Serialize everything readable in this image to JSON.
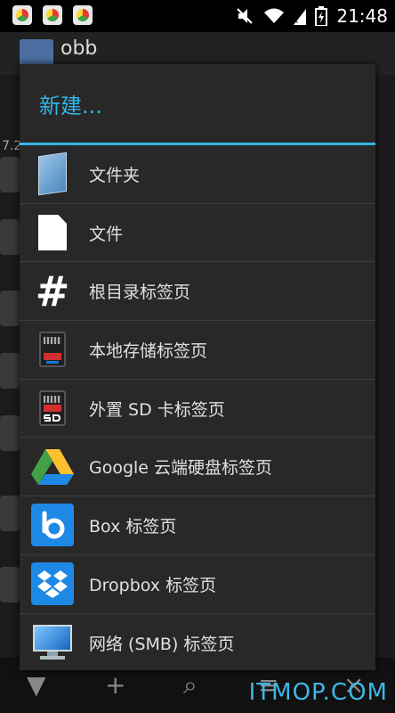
{
  "status_bar": {
    "time": "21:48",
    "icons": [
      "app-icon",
      "app-icon",
      "app-icon",
      "mute-icon",
      "wifi-icon",
      "signal-icon",
      "battery-icon"
    ]
  },
  "background": {
    "title": "obb",
    "side_text": "7.2",
    "watermark": "ITMOP.COM"
  },
  "dialog": {
    "title": "新建...",
    "accent_color": "#33b5e5",
    "items": [
      {
        "label": "文件夹",
        "icon": "folder-icon"
      },
      {
        "label": "文件",
        "icon": "file-icon"
      },
      {
        "label": "根目录标签页",
        "icon": "hash-icon"
      },
      {
        "label": "本地存储标签页",
        "icon": "sdcard-icon"
      },
      {
        "label": "外置 SD 卡标签页",
        "icon": "external-sdcard-icon"
      },
      {
        "label": "Google 云端硬盘标签页",
        "icon": "google-drive-icon"
      },
      {
        "label": "Box 标签页",
        "icon": "box-icon"
      },
      {
        "label": "Dropbox 标签页",
        "icon": "dropbox-icon"
      },
      {
        "label": "网络 (SMB) 标签页",
        "icon": "network-monitor-icon"
      }
    ]
  }
}
